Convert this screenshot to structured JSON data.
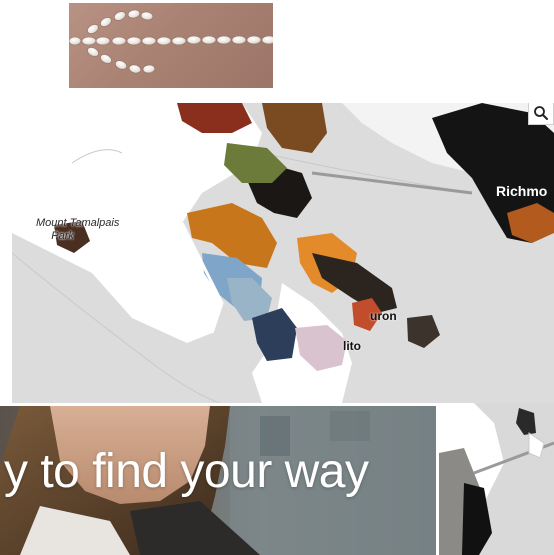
{
  "header_image": {
    "icon": "stone-arrow-left-icon",
    "background_color": "#a98273"
  },
  "map": {
    "labels": {
      "tamalpais": "Mount Tamalpais\n     Park",
      "richmond": "Richmo",
      "tiburon": "uron",
      "sausalito": "lito"
    },
    "search_icon": "search-icon",
    "water_color": "#dcdcdc",
    "land_color": "#ffffff"
  },
  "video": {
    "headline": "y to find your way"
  }
}
